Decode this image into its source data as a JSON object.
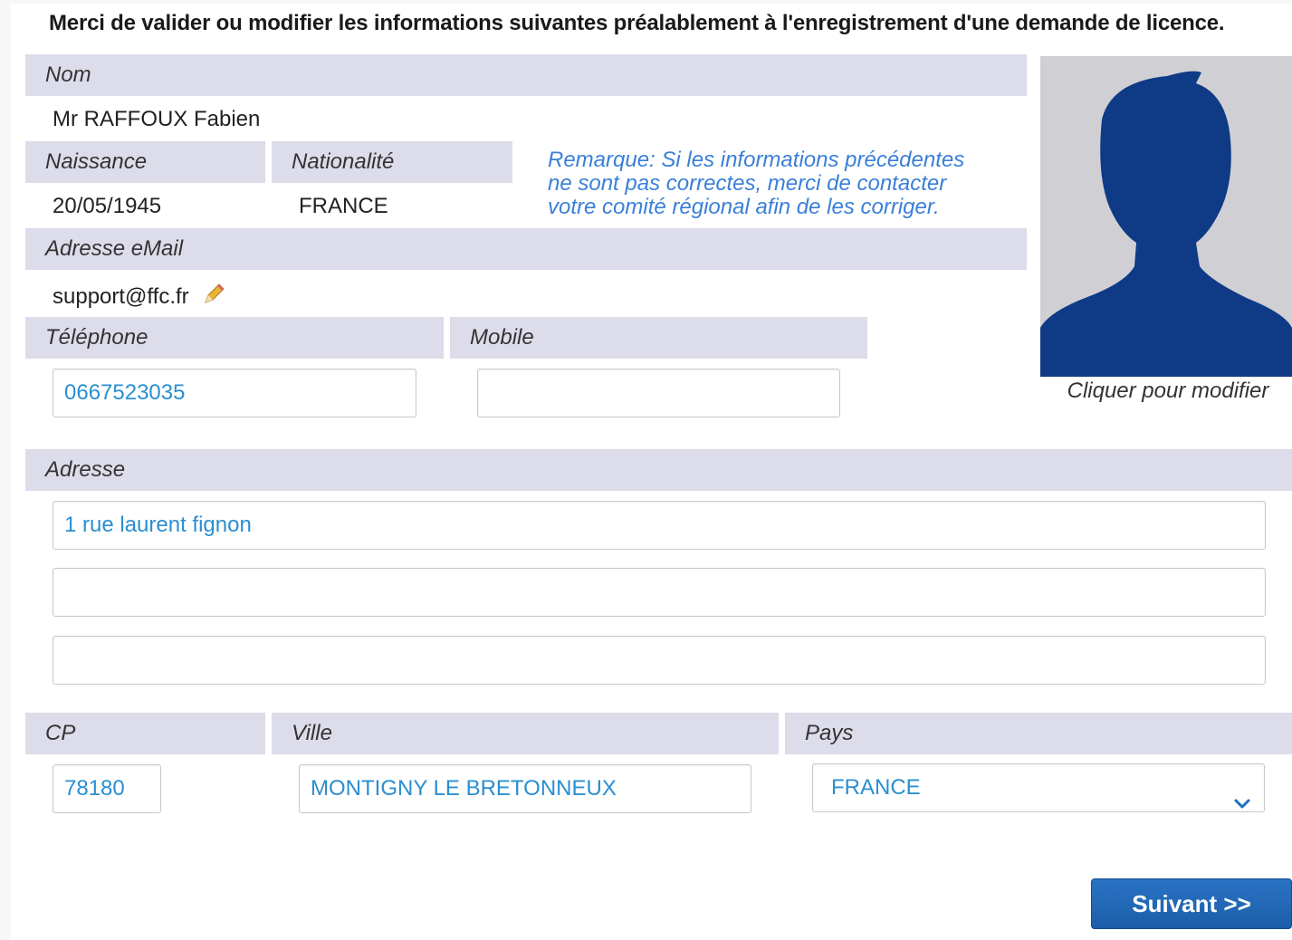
{
  "intro": "Merci de valider ou modifier les informations suivantes préalablement à l'enregistrement d'une demande de licence.",
  "nom": {
    "label": "Nom",
    "value": "Mr RAFFOUX Fabien"
  },
  "naissance": {
    "label": "Naissance",
    "value": "20/05/1945"
  },
  "nationalite": {
    "label": "Nationalité",
    "value": "FRANCE"
  },
  "remarque": [
    "Remarque: Si les informations précédentes",
    "ne sont pas correctes, merci de contacter",
    "votre comité régional afin de les corriger."
  ],
  "email": {
    "label": "Adresse eMail",
    "value": "support@ffc.fr"
  },
  "telephone": {
    "label": "Téléphone",
    "value": "0667523035"
  },
  "mobile": {
    "label": "Mobile",
    "value": ""
  },
  "adresse": {
    "label": "Adresse",
    "line1": "1 rue laurent fignon",
    "line2": "",
    "line3": ""
  },
  "cp": {
    "label": "CP",
    "value": "78180"
  },
  "ville": {
    "label": "Ville",
    "value": "MONTIGNY LE BRETONNEUX"
  },
  "pays": {
    "label": "Pays",
    "value": "FRANCE"
  },
  "photo": {
    "caption": "Cliquer pour modifier",
    "icon": "avatar-silhouette-icon"
  },
  "actions": {
    "next_label": "Suivant >>"
  },
  "colors": {
    "label_bar": "#dcdcea",
    "field_text": "#2a8fd0",
    "remark_text": "#3a7fd8",
    "button": "#1b5ea8",
    "silhouette": "#0f3a86"
  }
}
